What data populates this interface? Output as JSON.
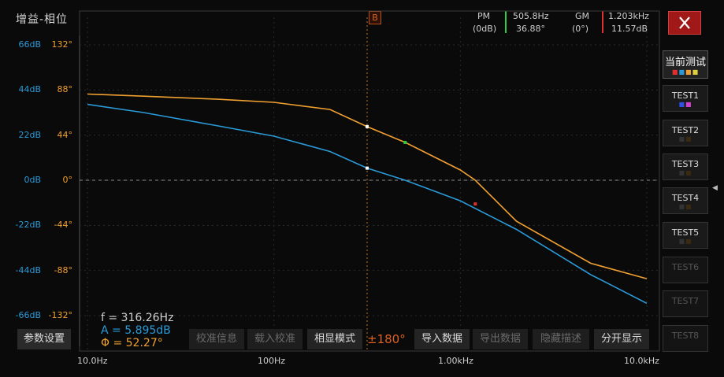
{
  "header": {
    "mode_button": "增益-相位",
    "marker_b": "B",
    "pm_label": "PM",
    "pm_unit": "(0dB)",
    "pm_freq": "505.8Hz",
    "pm_value": "36.88°",
    "gm_label": "GM",
    "gm_unit": "(0°)",
    "gm_freq": "1.203kHz",
    "gm_value": "11.57dB",
    "close_icon": "close-icon"
  },
  "gain_ticks": [
    "66dB",
    "44dB",
    "22dB",
    "0dB",
    "-22dB",
    "-44dB",
    "-66dB"
  ],
  "phase_ticks": [
    "132°",
    "88°",
    "44°",
    "0°",
    "-44°",
    "-88°",
    "-132°"
  ],
  "x_ticks": [
    "10.0Hz",
    "100Hz",
    "1.00kHz",
    "10.0kHz"
  ],
  "cursor_readout": {
    "freq": "f = 316.26Hz",
    "gain": "A = 5.895dB",
    "phase": "Φ = 52.27°"
  },
  "bottom_buttons": {
    "params": "参数设置",
    "calib_info": "校准信息",
    "load_calib": "载入校准",
    "phase_mode": "相显模式",
    "phase_range": "±180°",
    "import": "导入数据",
    "export": "导出数据",
    "hide_desc": "隐藏描述",
    "split_view": "分开显示"
  },
  "side_panel": {
    "current": "当前测试",
    "tests": [
      "TEST1",
      "TEST2",
      "TEST3",
      "TEST4",
      "TEST5",
      "TEST6",
      "TEST7",
      "TEST8"
    ],
    "collapse_icon": "chevron-left-icon"
  },
  "colors": {
    "gain": "#2a9ad8",
    "phase": "#f0a030",
    "pm_bar": "#2ecc40",
    "gm_bar": "#e03030",
    "close_bg": "#a01818"
  },
  "chart_data": {
    "type": "line",
    "x_scale": "log",
    "xlim": [
      10,
      10000
    ],
    "gain_ylim": [
      -66,
      66
    ],
    "phase_ylim": [
      -132,
      132
    ],
    "cursor_freq_hz": 316.26,
    "series": [
      {
        "name": "A",
        "axis": "gain",
        "x": [
          10,
          20,
          50,
          100,
          200,
          316.26,
          505.8,
          1000,
          2000,
          5000,
          10000
        ],
        "values": [
          37,
          33,
          26.5,
          21.5,
          14,
          5.9,
          0,
          -10,
          -24,
          -46,
          -60
        ]
      },
      {
        "name": "Φ",
        "axis": "phase",
        "x": [
          10,
          20,
          50,
          100,
          200,
          316.26,
          505.8,
          1000,
          1203,
          2000,
          5000,
          10000
        ],
        "values": [
          84,
          82,
          79,
          76,
          69,
          52.27,
          36.88,
          10,
          0,
          -40,
          -81,
          -96
        ]
      }
    ]
  }
}
